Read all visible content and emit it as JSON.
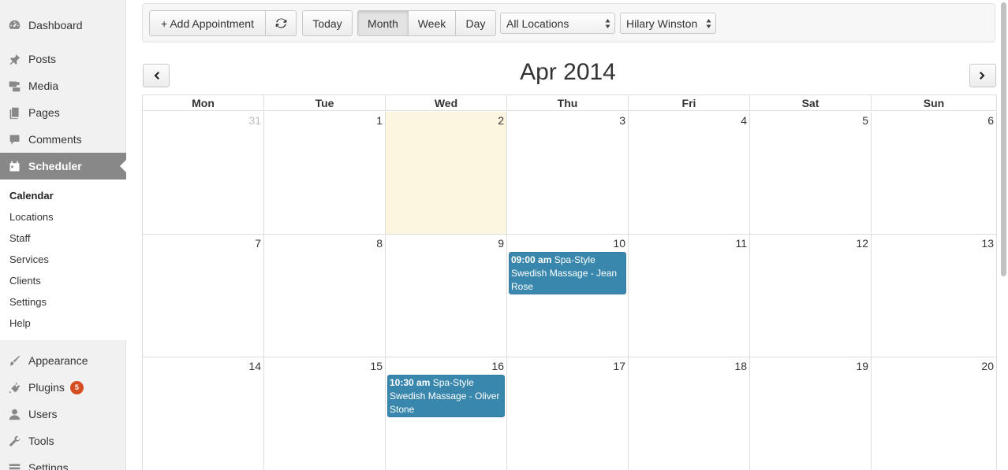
{
  "sidebar": {
    "items": [
      {
        "label": "Dashboard",
        "icon": "dashboard-icon"
      },
      {
        "label": "Posts",
        "icon": "pin-icon"
      },
      {
        "label": "Media",
        "icon": "media-icon"
      },
      {
        "label": "Pages",
        "icon": "pages-icon"
      },
      {
        "label": "Comments",
        "icon": "comment-icon"
      },
      {
        "label": "Scheduler",
        "icon": "calendar-icon",
        "active": true
      }
    ],
    "submenu": [
      "Calendar",
      "Locations",
      "Staff",
      "Services",
      "Clients",
      "Settings",
      "Help"
    ],
    "lower_items": [
      {
        "label": "Appearance",
        "icon": "brush-icon"
      },
      {
        "label": "Plugins",
        "icon": "plugin-icon",
        "badge": "5"
      },
      {
        "label": "Users",
        "icon": "user-icon"
      },
      {
        "label": "Tools",
        "icon": "wrench-icon"
      },
      {
        "label": "Settings",
        "icon": "settings-icon"
      }
    ]
  },
  "toolbar": {
    "add_label": "+ Add Appointment",
    "refresh_icon": "refresh-icon",
    "today_label": "Today",
    "view_month": "Month",
    "view_week": "Week",
    "view_day": "Day",
    "active_view": "Month",
    "location_select": "All Locations",
    "staff_select": "Hilary Winston"
  },
  "calendar": {
    "title": "Apr 2014",
    "weekdays": [
      "Mon",
      "Tue",
      "Wed",
      "Thu",
      "Fri",
      "Sat",
      "Sun"
    ],
    "weeks": [
      [
        {
          "d": "31",
          "other": true
        },
        {
          "d": "1"
        },
        {
          "d": "2",
          "today": true
        },
        {
          "d": "3"
        },
        {
          "d": "4"
        },
        {
          "d": "5"
        },
        {
          "d": "6"
        }
      ],
      [
        {
          "d": "7"
        },
        {
          "d": "8"
        },
        {
          "d": "9"
        },
        {
          "d": "10",
          "event": {
            "time": "09:00 am",
            "title": "Spa-Style Swedish Massage - Jean Rose"
          }
        },
        {
          "d": "11"
        },
        {
          "d": "12"
        },
        {
          "d": "13"
        }
      ],
      [
        {
          "d": "14"
        },
        {
          "d": "15"
        },
        {
          "d": "16",
          "event": {
            "time": "10:30 am",
            "title": "Spa-Style Swedish Massage - Oliver Stone"
          }
        },
        {
          "d": "17"
        },
        {
          "d": "18"
        },
        {
          "d": "19"
        },
        {
          "d": "20"
        }
      ]
    ],
    "event_color": "#3a87ad",
    "today_color": "#fcf6e0"
  }
}
